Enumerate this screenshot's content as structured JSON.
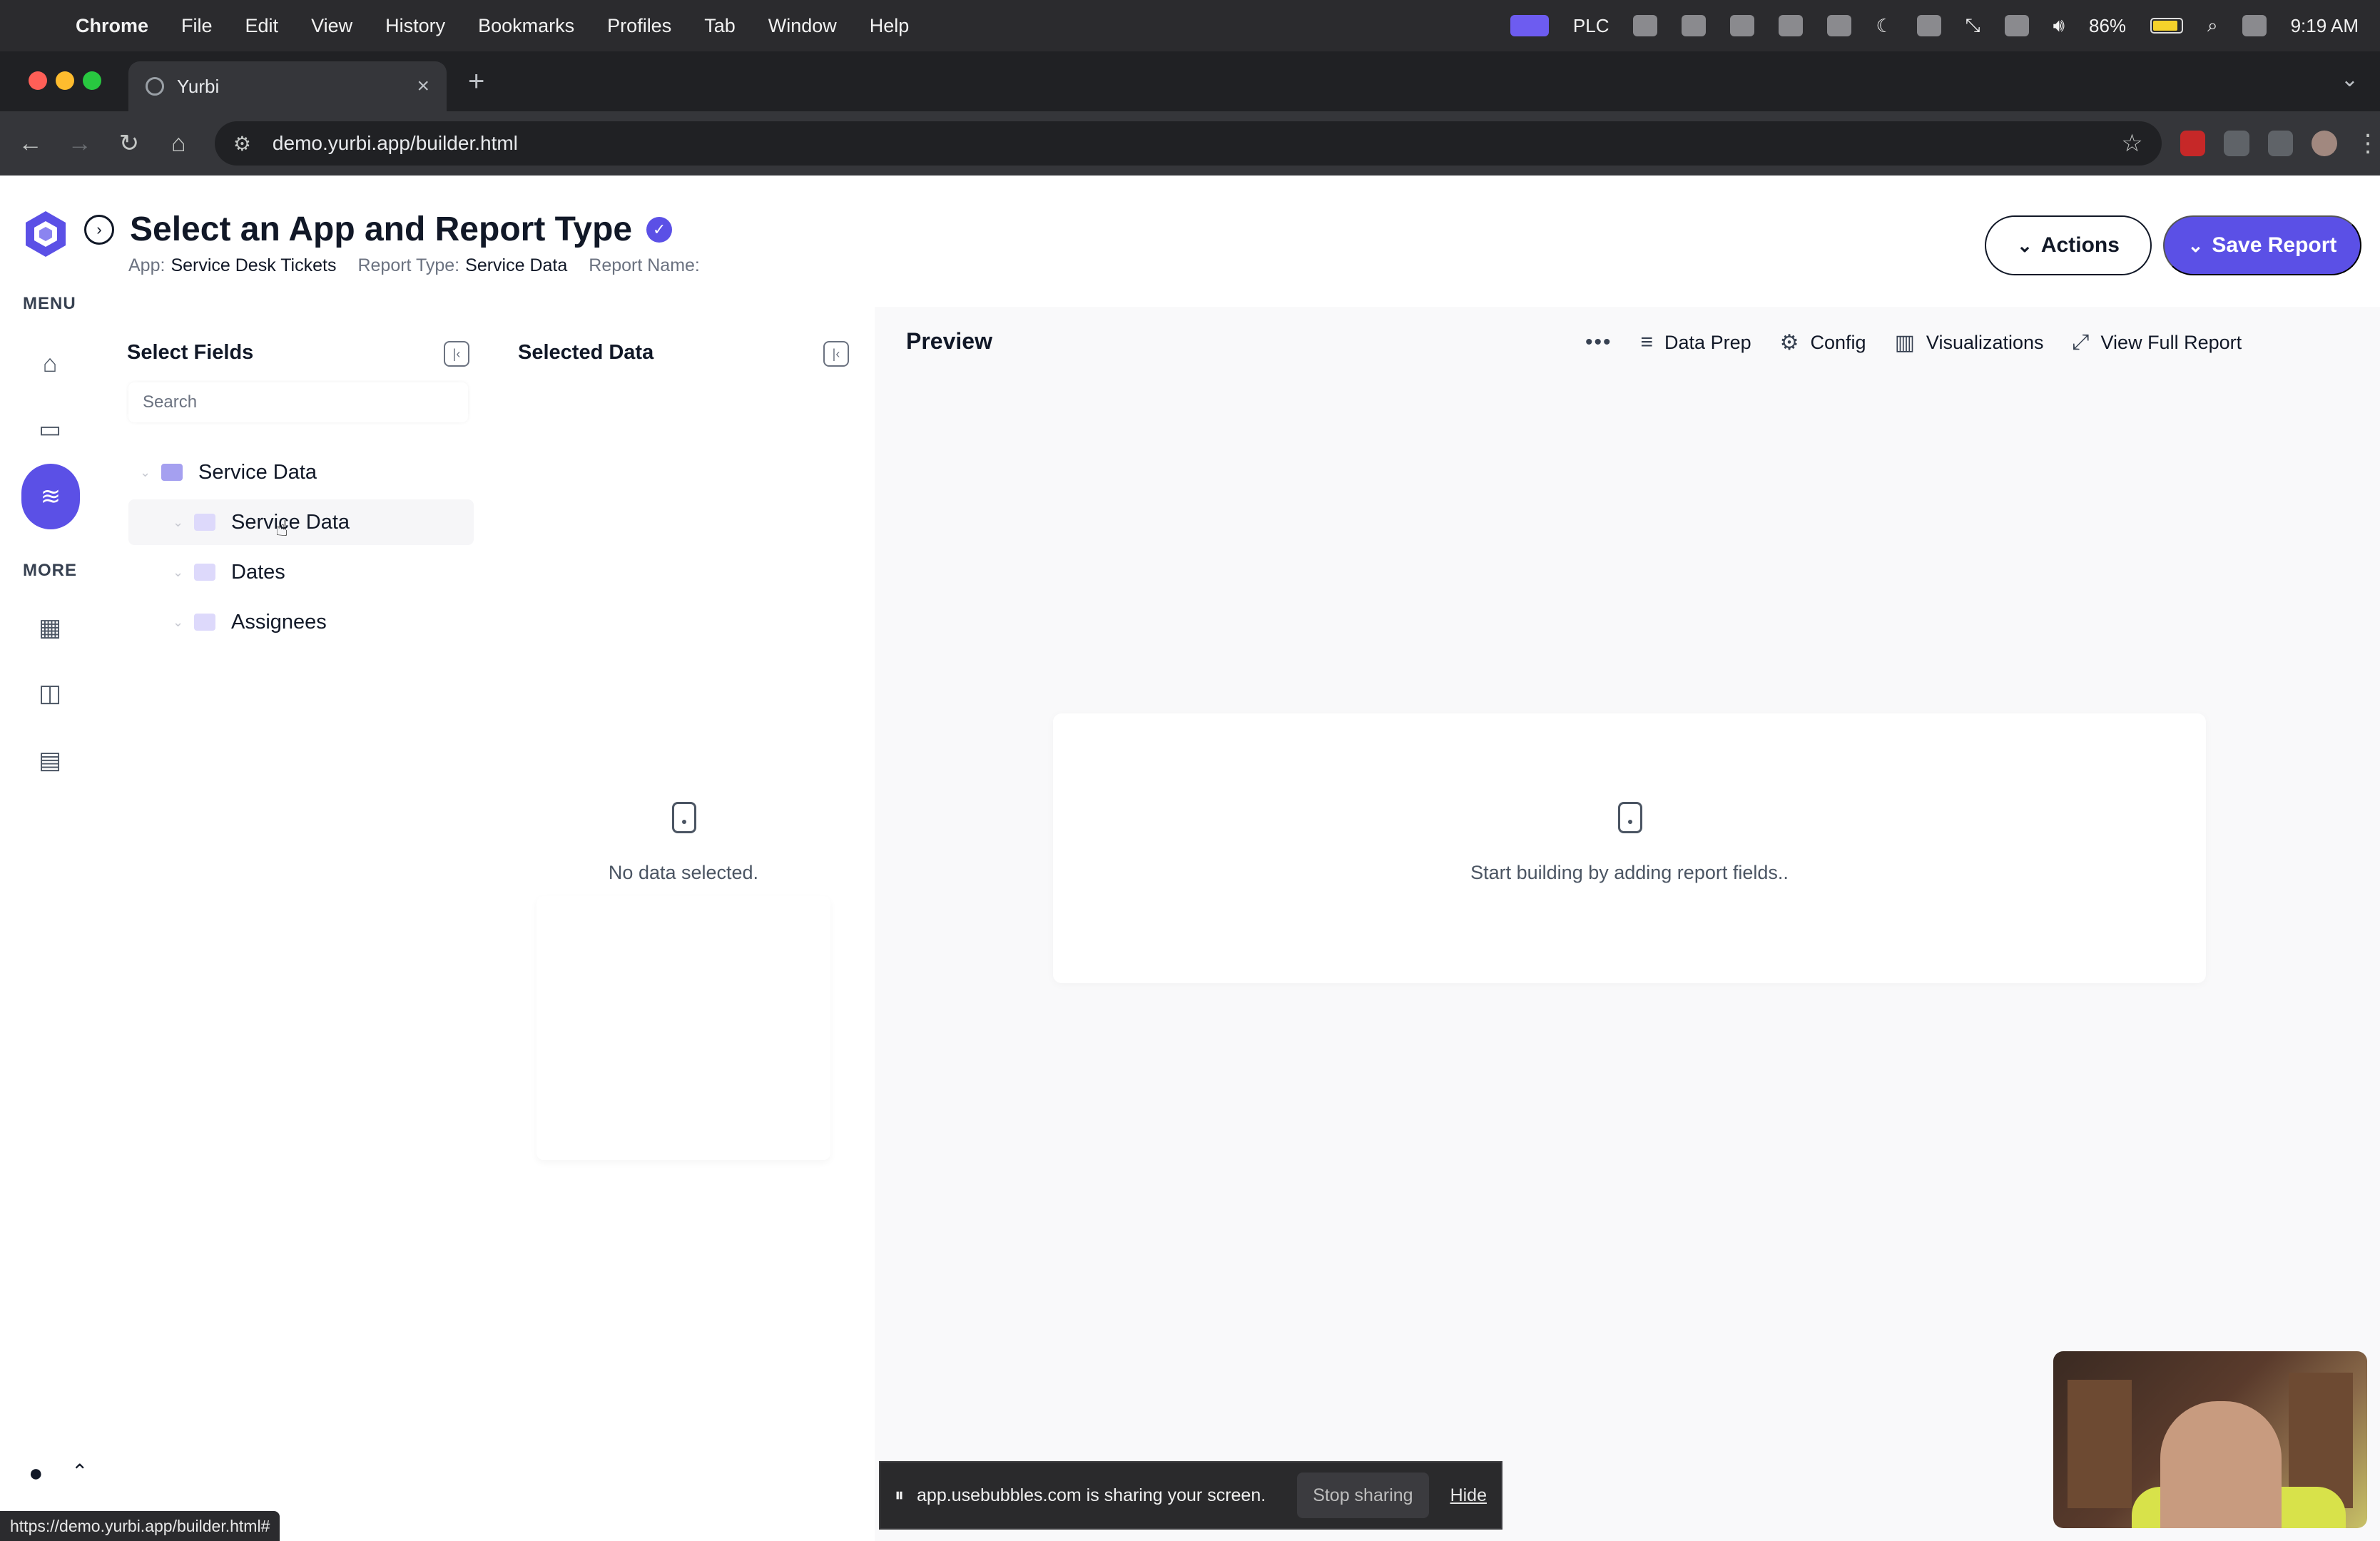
{
  "macos": {
    "app_name": "Chrome",
    "menu": [
      "File",
      "Edit",
      "View",
      "History",
      "Bookmarks",
      "Profiles",
      "Tab",
      "Window",
      "Help"
    ],
    "tray_plc": "PLC",
    "battery": "86%",
    "clock": "9:19 AM"
  },
  "browser": {
    "tab_title": "Yurbi",
    "url": "demo.yurbi.app/builder.html",
    "status_url": "https://demo.yurbi.app/builder.html#"
  },
  "nav": {
    "menu_label": "MENU",
    "more_label": "MORE"
  },
  "header": {
    "title": "Select an App and Report Type",
    "app_label": "App:",
    "app_value": "Service Desk Tickets",
    "report_type_label": "Report Type:",
    "report_type_value": "Service Data",
    "report_name_label": "Report Name:",
    "actions_label": "Actions",
    "save_label": "Save Report"
  },
  "select_fields": {
    "title": "Select Fields",
    "search_placeholder": "Search",
    "root": "Service Data",
    "children": [
      "Service Data",
      "Dates",
      "Assignees"
    ]
  },
  "selected_data": {
    "title": "Selected Data",
    "empty_text": "No data selected."
  },
  "preview": {
    "title": "Preview",
    "tools": {
      "data_prep": "Data Prep",
      "config": "Config",
      "visualizations": "Visualizations",
      "view_full_report": "View Full Report"
    },
    "empty_text": "Start building by adding report fields.."
  },
  "screenshare": {
    "message": "app.usebubbles.com is sharing your screen.",
    "stop_label": "Stop sharing",
    "hide_label": "Hide"
  },
  "colors": {
    "accent": "#5b50e6",
    "folder": "#a5a0f0"
  }
}
